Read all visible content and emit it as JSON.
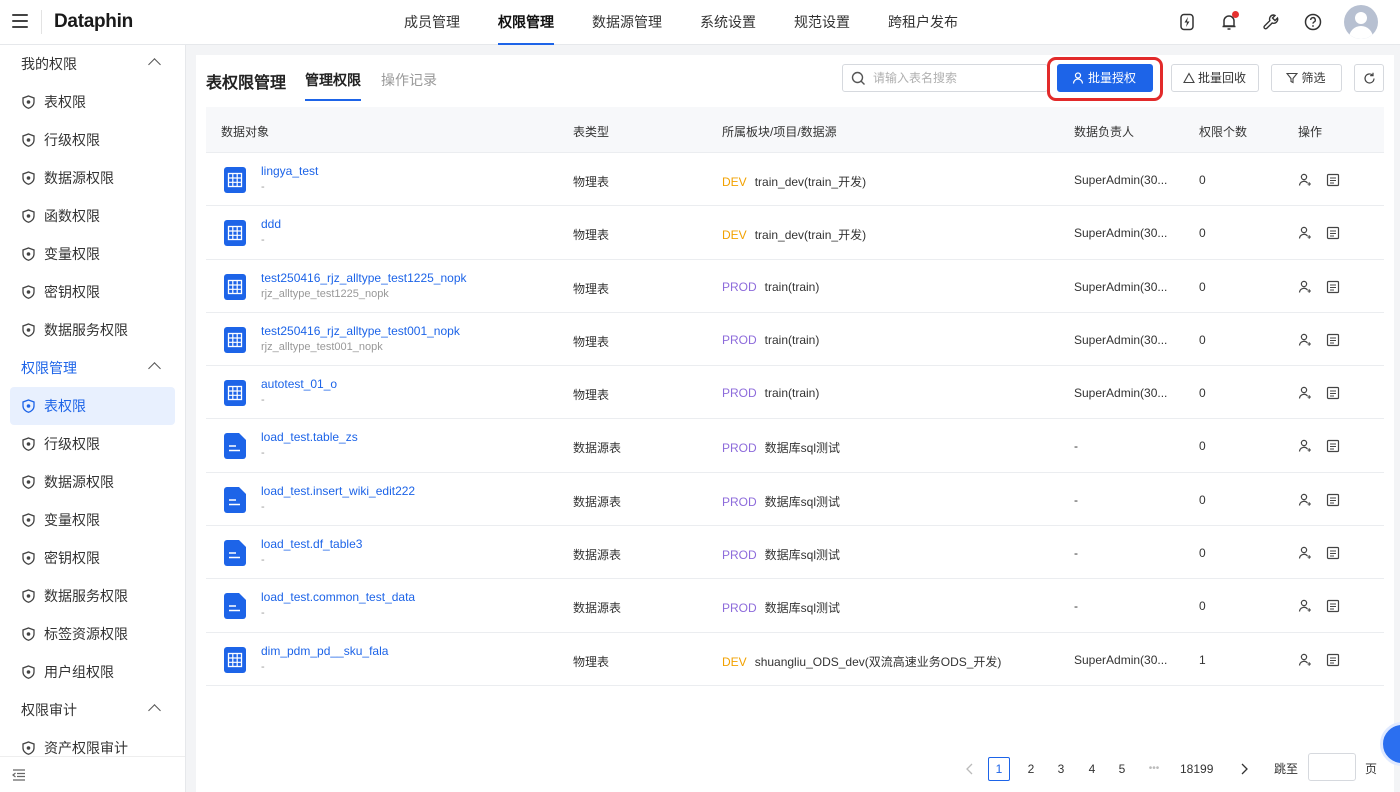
{
  "app": {
    "logo": "Dataphin"
  },
  "topnav": [
    "成员管理",
    "权限管理",
    "数据源管理",
    "系统设置",
    "规范设置",
    "跨租户发布"
  ],
  "topnav_active": 1,
  "sidebar": {
    "groups": [
      {
        "label": "我的权限",
        "color": "default",
        "items": [
          "表权限",
          "行级权限",
          "数据源权限",
          "函数权限",
          "变量权限",
          "密钥权限",
          "数据服务权限"
        ]
      },
      {
        "label": "权限管理",
        "color": "blue",
        "items": [
          "表权限",
          "行级权限",
          "数据源权限",
          "变量权限",
          "密钥权限",
          "数据服务权限",
          "标签资源权限",
          "用户组权限"
        ]
      },
      {
        "label": "权限审计",
        "color": "default",
        "items": [
          "资产权限审计"
        ]
      }
    ]
  },
  "page": {
    "title": "表权限管理",
    "tabs": [
      "管理权限",
      "操作记录"
    ],
    "search_placeholder": "请输入表名搜索",
    "buttons": {
      "batch_grant": "批量授权",
      "batch_revoke": "批量回收",
      "filter": "筛选"
    }
  },
  "table": {
    "headers": [
      "数据对象",
      "表类型",
      "所属板块/项目/数据源",
      "数据负责人",
      "权限个数",
      "操作"
    ],
    "rows": [
      {
        "name": "lingya_test",
        "sub": "-",
        "type": "物理表",
        "env": "DEV",
        "project": "train_dev(train_开发)",
        "owner": "SuperAdmin(30...",
        "count": "0",
        "icon": "table"
      },
      {
        "name": "ddd",
        "sub": "-",
        "type": "物理表",
        "env": "DEV",
        "project": "train_dev(train_开发)",
        "owner": "SuperAdmin(30...",
        "count": "0",
        "icon": "table"
      },
      {
        "name": "test250416_rjz_alltype_test1225_nopk",
        "sub": "rjz_alltype_test1225_nopk",
        "type": "物理表",
        "env": "PROD",
        "project": "train(train)",
        "owner": "SuperAdmin(30...",
        "count": "0",
        "icon": "table"
      },
      {
        "name": "test250416_rjz_alltype_test001_nopk",
        "sub": "rjz_alltype_test001_nopk",
        "type": "物理表",
        "env": "PROD",
        "project": "train(train)",
        "owner": "SuperAdmin(30...",
        "count": "0",
        "icon": "table"
      },
      {
        "name": "autotest_01_o",
        "sub": "-",
        "type": "物理表",
        "env": "PROD",
        "project": "train(train)",
        "owner": "SuperAdmin(30...",
        "count": "0",
        "icon": "table"
      },
      {
        "name": "load_test.table_zs",
        "sub": "-",
        "type": "数据源表",
        "env": "PROD",
        "project": "数据库sql测试",
        "owner": "-",
        "count": "0",
        "icon": "doc"
      },
      {
        "name": "load_test.insert_wiki_edit222",
        "sub": "-",
        "type": "数据源表",
        "env": "PROD",
        "project": "数据库sql测试",
        "owner": "-",
        "count": "0",
        "icon": "doc"
      },
      {
        "name": "load_test.df_table3",
        "sub": "-",
        "type": "数据源表",
        "env": "PROD",
        "project": "数据库sql测试",
        "owner": "-",
        "count": "0",
        "icon": "doc"
      },
      {
        "name": "load_test.common_test_data",
        "sub": "-",
        "type": "数据源表",
        "env": "PROD",
        "project": "数据库sql测试",
        "owner": "-",
        "count": "0",
        "icon": "doc"
      },
      {
        "name": "dim_pdm_pd__sku_fala",
        "sub": "-",
        "type": "物理表",
        "env": "DEV",
        "project": "shuangliu_ODS_dev(双流高速业务ODS_开发)",
        "owner": "SuperAdmin(30...",
        "count": "1",
        "icon": "table"
      }
    ]
  },
  "pagination": {
    "pages": [
      "1",
      "2",
      "3",
      "4",
      "5"
    ],
    "ellipsis": "•••",
    "last": "18199",
    "active": "1",
    "jump_label": "跳至",
    "page_unit": "页"
  },
  "colors": {
    "primary": "#1d64e8",
    "dev": "#f2a100",
    "prod": "#8d6bdb",
    "highlight": "#e22a2a"
  }
}
